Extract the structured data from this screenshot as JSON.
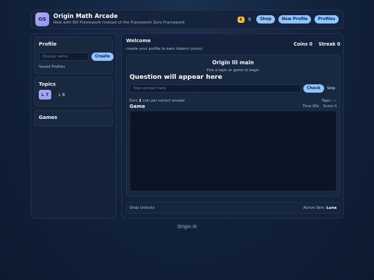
{
  "header": {
    "logo_text": "OS",
    "title": "Origin Math Arcade",
    "subtitle": "Now with IIIX Framework instead of the Framework Zero Framework",
    "coin_icon": "coin-icon",
    "coin_glyph": "€",
    "coin_count": "0",
    "buttons": {
      "shop": "Shop",
      "new_profile": "New Profile",
      "profiles": "Profiles"
    }
  },
  "sidebar": {
    "profile": {
      "title": "Profile",
      "name_placeholder": "Display name",
      "create_label": "Create",
      "saved_label": "Saved Profiles"
    },
    "topics": {
      "title": "Topics",
      "items": [
        {
          "label": "L 7",
          "active": true
        },
        {
          "label": "L 8",
          "active": false
        }
      ]
    },
    "games": {
      "title": "Games"
    }
  },
  "main": {
    "welcome_title": "Welcome",
    "welcome_sub": "create your profile to earn tokens (coins)",
    "coins_label": "Coins 0",
    "streak_label": "Streak 0",
    "play": {
      "title": "Origin III main",
      "subtitle": "Pick a topic or game to begin",
      "question": "Question will appear here",
      "answer_placeholder": "Type answer here",
      "check_label": "Check",
      "skip_label": "Skip",
      "earn_prefix": "Earn ",
      "earn_count": "1",
      "earn_suffix": " coin per correct answer",
      "topic_label": "Topic: —",
      "game_label": "Game",
      "time_label": "Time 60s",
      "score_label": "Score 0"
    },
    "footer": {
      "shop_unlocks": "Shop Unlocks",
      "active_skin_label": "Active Skin: ",
      "active_skin_value": "Luna"
    }
  },
  "page_footer": "Origin III",
  "colors": {
    "accent": "#8ec5ff",
    "coin": "#f5c542",
    "topic_chip_active": "#b8a6f5",
    "background": "#11213a"
  }
}
